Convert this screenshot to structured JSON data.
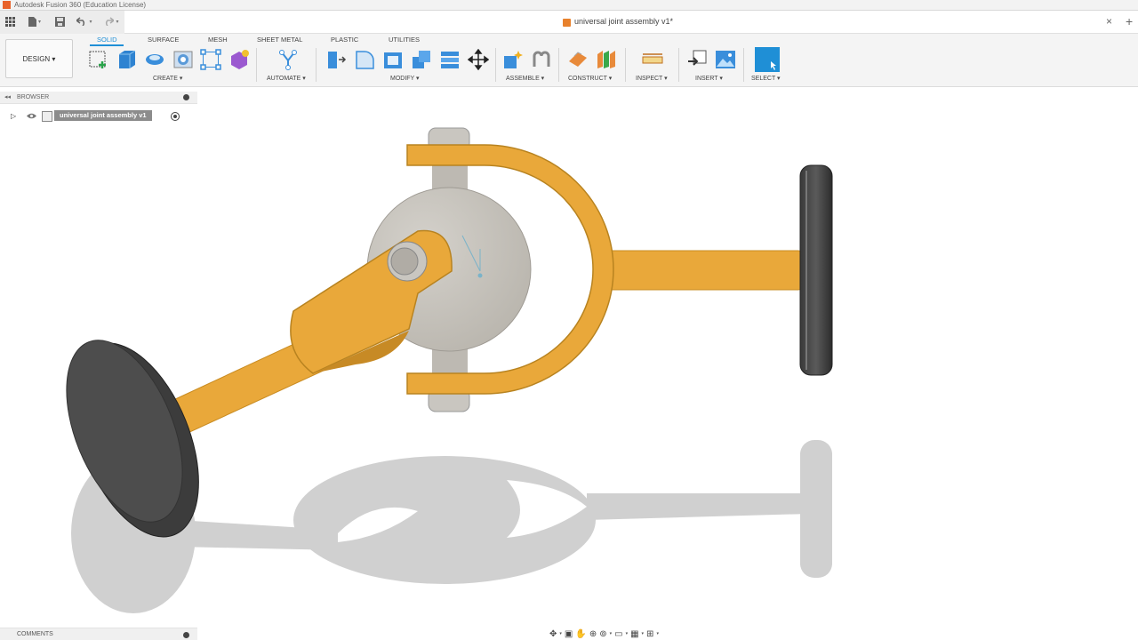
{
  "app": {
    "title": "Autodesk Fusion 360 (Education License)",
    "logo_color": "#e8622a"
  },
  "document": {
    "title": "universal joint assembly v1*",
    "close_symbol": "×",
    "add_symbol": "+"
  },
  "quick_access": {
    "grid_icon": "grid-icon",
    "file_icon": "file-icon",
    "save_icon": "save-icon",
    "undo_icon": "undo-icon",
    "redo_icon": "redo-icon"
  },
  "workspace": {
    "label": "DESIGN ▾"
  },
  "tabs": [
    {
      "label": "SOLID",
      "active": true
    },
    {
      "label": "SURFACE",
      "active": false
    },
    {
      "label": "MESH",
      "active": false
    },
    {
      "label": "SHEET METAL",
      "active": false
    },
    {
      "label": "PLASTIC",
      "active": false
    },
    {
      "label": "UTILITIES",
      "active": false
    }
  ],
  "groups": {
    "create": "CREATE ▾",
    "automate": "AUTOMATE ▾",
    "modify": "MODIFY ▾",
    "assemble": "ASSEMBLE ▾",
    "construct": "CONSTRUCT ▾",
    "inspect": "INSPECT ▾",
    "insert": "INSERT ▾",
    "select": "SELECT ▾"
  },
  "browser": {
    "title": "BROWSER",
    "root_component": "universal joint assembly v1"
  },
  "comments": {
    "title": "COMMENTS"
  },
  "colors": {
    "accent": "#1f8fd6",
    "part_orange": "#e9a83a",
    "part_gray": "#c7c4be",
    "wheel_dark": "#4a4a4a",
    "shadow": "#d0d0d0"
  }
}
